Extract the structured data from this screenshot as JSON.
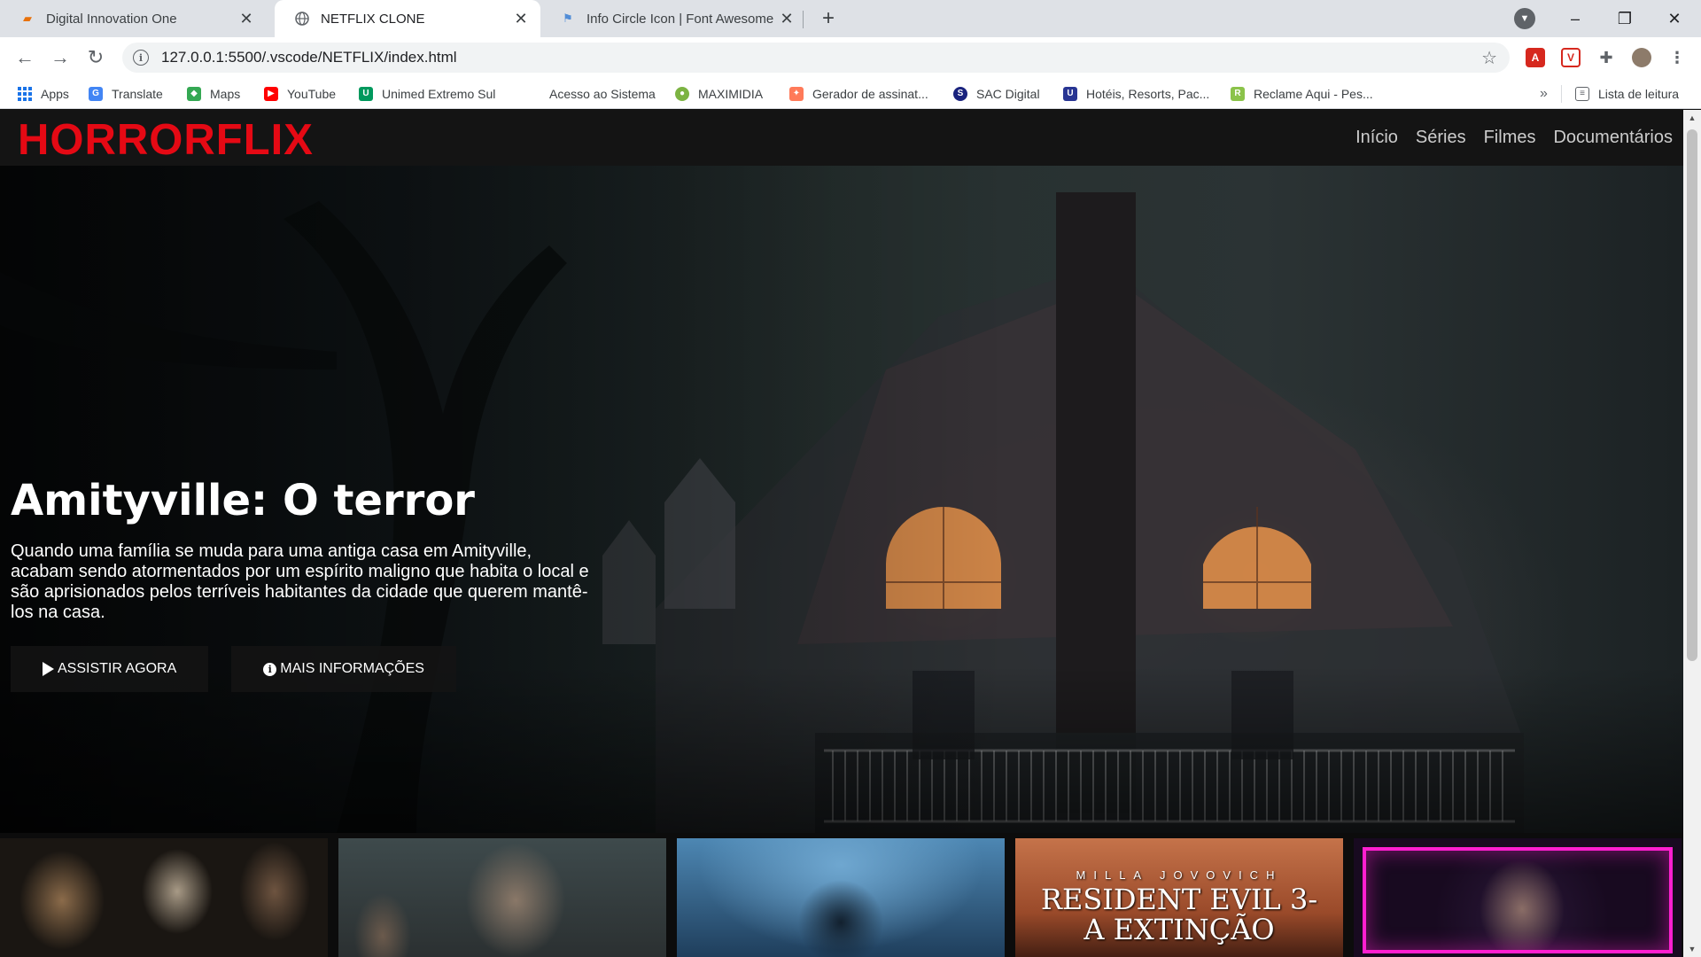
{
  "browser": {
    "tabs": [
      {
        "title": "Digital Innovation One",
        "active": false
      },
      {
        "title": "NETFLIX CLONE",
        "active": true
      },
      {
        "title": "Info Circle Icon | Font Awesome",
        "active": false
      }
    ],
    "url": "127.0.0.1:5500/.vscode/NETFLIX/index.html",
    "bookmarks": [
      {
        "label": "Apps"
      },
      {
        "label": "Translate"
      },
      {
        "label": "Maps"
      },
      {
        "label": "YouTube"
      },
      {
        "label": "Unimed Extremo Sul"
      },
      {
        "label": "Acesso ao Sistema"
      },
      {
        "label": "MAXIMIDIA"
      },
      {
        "label": "Gerador de assinat..."
      },
      {
        "label": "SAC Digital"
      },
      {
        "label": "Hotéis, Resorts, Pac..."
      },
      {
        "label": "Reclame Aqui - Pes..."
      }
    ],
    "more_bookmarks": "»",
    "reading_list": "Lista de leitura"
  },
  "site": {
    "logo": "HORRORFLIX",
    "nav": [
      "Início",
      "Séries",
      "Filmes",
      "Documentários"
    ],
    "hero": {
      "title": "Amityville: O terror",
      "description": "Quando uma família se muda para uma antiga casa em Amityville, acabam sendo atormentados por um espírito maligno que habita o local e são aprisionados pelos terríveis habitantes da cidade que querem mantê-los na casa.",
      "buttons": [
        "ASSISTIR AGORA",
        "MAIS INFORMAÇÕES"
      ]
    },
    "posters": [
      {
        "name": "poster-halloween",
        "text_top": "",
        "text_main": ""
      },
      {
        "name": "poster-walking-dead",
        "text_top": "",
        "text_main": ""
      },
      {
        "name": "poster-underworld",
        "text_top": "",
        "text_main": ""
      },
      {
        "name": "poster-resident-evil-3",
        "text_top": "MILLA JOVOVICH",
        "text_main": "RESIDENT EVIL 3-",
        "text_sub": "A EXTINÇÃO"
      },
      {
        "name": "poster-neon-portrait",
        "text_top": "",
        "text_main": ""
      }
    ]
  },
  "colors": {
    "brand_red": "#e50914",
    "header_bg": "#141414"
  }
}
